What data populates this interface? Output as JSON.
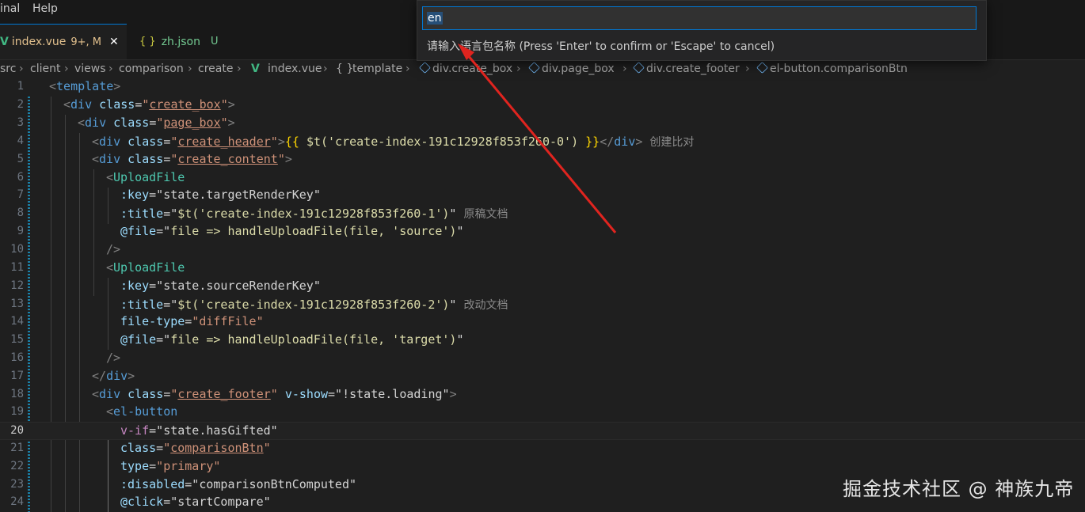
{
  "menubar": {
    "items": [
      "inal",
      "Help"
    ]
  },
  "tabs": [
    {
      "icon": "vue-icon",
      "label": "index.vue",
      "badge": "9+, M",
      "active": true,
      "close": "✕"
    },
    {
      "icon": "json-icon",
      "icon_text": "{ }",
      "label": "zh.json",
      "badge": "U",
      "active": false
    }
  ],
  "breadcrumb": {
    "segments": [
      "src",
      "client",
      "views",
      "comparison",
      "create",
      "index.vue",
      "template",
      "div.create_box",
      "div.page_box",
      "div.create_footer",
      "el-button.comparisonBtn"
    ],
    "template_icon": "{ }"
  },
  "quick_input": {
    "value": "en",
    "message": "请输入语言包名称 (Press 'Enter' to confirm or 'Escape' to cancel)"
  },
  "editor": {
    "current_line": 20,
    "lines": [
      {
        "n": "1"
      },
      {
        "n": "2"
      },
      {
        "n": "3"
      },
      {
        "n": "4"
      },
      {
        "n": "5"
      },
      {
        "n": "6"
      },
      {
        "n": "7"
      },
      {
        "n": "8"
      },
      {
        "n": "9"
      },
      {
        "n": "10"
      },
      {
        "n": "11"
      },
      {
        "n": "12"
      },
      {
        "n": "13"
      },
      {
        "n": "14"
      },
      {
        "n": "15"
      },
      {
        "n": "16"
      },
      {
        "n": "17"
      },
      {
        "n": "18"
      },
      {
        "n": "19"
      },
      {
        "n": "20"
      },
      {
        "n": "21"
      },
      {
        "n": "22"
      },
      {
        "n": "23"
      },
      {
        "n": "24"
      }
    ],
    "code": {
      "template": "template",
      "div": "div",
      "class": "class",
      "create_box": "create_box",
      "page_box": "page_box",
      "create_header": "create_header",
      "header_expr": "$t('create-index-191c12928f853f260-0')",
      "header_hint": "创建比对",
      "create_content": "create_content",
      "UploadFile": "UploadFile",
      "key": ":key",
      "target_key": "state.targetRenderKey",
      "source_key": "state.sourceRenderKey",
      "title": ":title",
      "title1": "$t('create-index-191c12928f853f260-1')",
      "title1_hint": "原稿文档",
      "title2": "$t('create-index-191c12928f853f260-2')",
      "title2_hint": "改动文档",
      "file_event": "@file",
      "file_handler_source": "file => handleUploadFile(file, 'source')",
      "file_handler_target": "file => handleUploadFile(file, 'target')",
      "file_type": "file-type",
      "file_type_val": "diffFile",
      "create_footer": "create_footer",
      "v_show": "v-show",
      "v_show_val": "!state.loading",
      "el_button": "el-button",
      "v_if": "v-if",
      "v_if_val": "state.hasGifted",
      "comparisonBtn": "comparisonBtn",
      "type": "type",
      "type_val": "primary",
      "disabled": ":disabled",
      "disabled_val": "comparisonBtnComputed",
      "click": "@click",
      "click_val": "startCompare"
    }
  },
  "watermark": "掘金技术社区 @ 神族九帝",
  "colors": {
    "accent": "#0078d4",
    "vue": "#41b883",
    "arrow": "#e0241f",
    "modified_tab": "#e2c08d",
    "untracked": "#73c991"
  }
}
